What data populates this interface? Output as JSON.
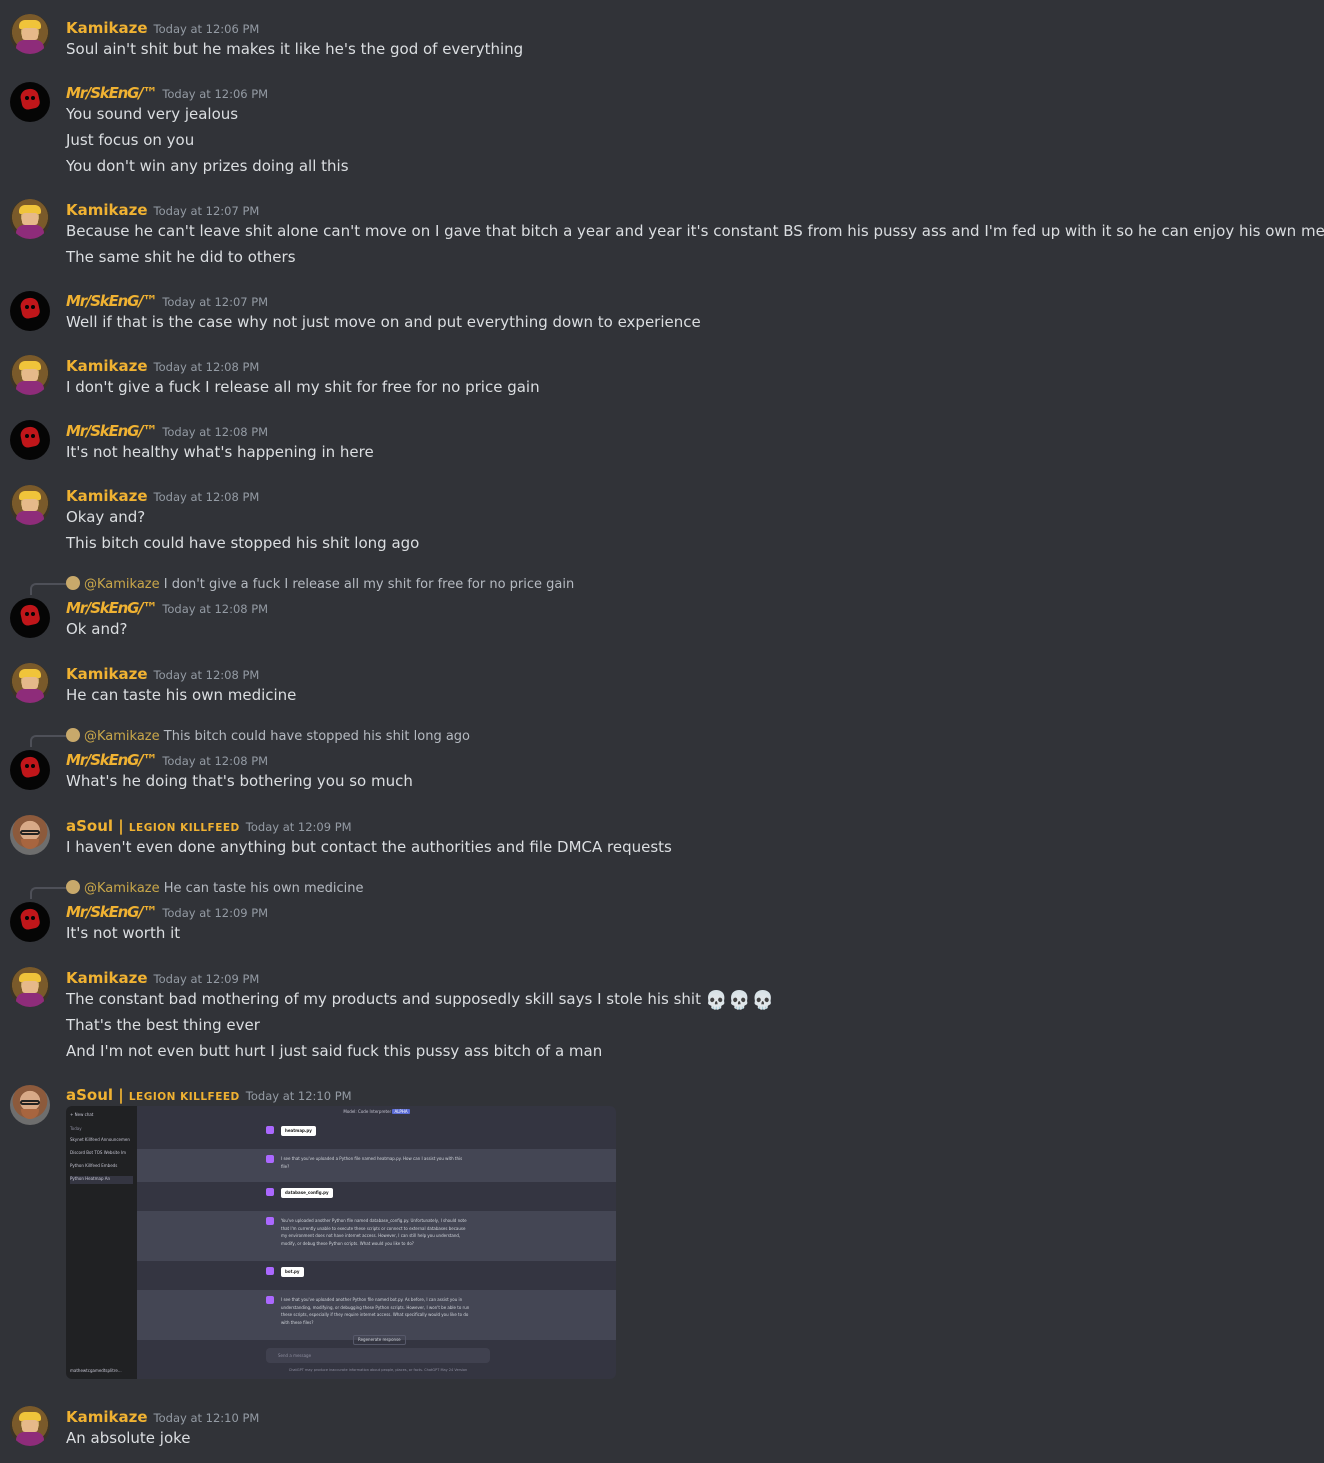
{
  "messages": [
    {
      "user": "Kamikaze",
      "time": "Today at 12:06 PM",
      "lines": [
        "Soul ain't shit but he makes it like he's the god of everything"
      ]
    },
    {
      "user": "Mr/SkEnG/™",
      "time": "Today at 12:06 PM",
      "lines": [
        "You sound very jealous",
        "Just focus on you",
        "You don't win any prizes doing all this"
      ]
    },
    {
      "user": "Kamikaze",
      "time": "Today at 12:07 PM",
      "lines": [
        "Because he can't leave shit alone can't move on I gave that bitch a year and year it's constant BS from his pussy ass and I'm fed up with it so he can enjoy his own medicine",
        "The same shit he did to others"
      ]
    },
    {
      "user": "Mr/SkEnG/™",
      "time": "Today at 12:07 PM",
      "lines": [
        "Well if that is the case why not just move on and put everything down to experience"
      ]
    },
    {
      "user": "Kamikaze",
      "time": "Today at 12:08 PM",
      "lines": [
        "I don't give a fuck I release all my shit for free for no price gain"
      ]
    },
    {
      "user": "Mr/SkEnG/™",
      "time": "Today at 12:08 PM",
      "lines": [
        "It's not healthy what's happening in here"
      ]
    },
    {
      "user": "Kamikaze",
      "time": "Today at 12:08 PM",
      "lines": [
        "Okay and?",
        "This bitch could have stopped his shit long ago"
      ]
    },
    {
      "reply_mention": "@Kamikaze",
      "reply_text": "I don't give a fuck I release all my shit for free for no price gain",
      "user": "Mr/SkEnG/™",
      "time": "Today at 12:08 PM",
      "lines": [
        "Ok and?"
      ]
    },
    {
      "user": "Kamikaze",
      "time": "Today at 12:08 PM",
      "lines": [
        "He can taste his own medicine"
      ]
    },
    {
      "reply_mention": "@Kamikaze",
      "reply_text": "This bitch could have stopped his shit long ago",
      "user": "Mr/SkEnG/™",
      "time": "Today at 12:08 PM",
      "lines": [
        "What's he doing that's bothering you so much"
      ]
    },
    {
      "user": "aSoul |",
      "tag": "LEGION KILLFEED",
      "time": "Today at 12:09 PM",
      "lines": [
        "I haven't even done anything but contact the authorities and file DMCA requests"
      ]
    },
    {
      "reply_mention": "@Kamikaze",
      "reply_text": "He can taste his own medicine",
      "user": "Mr/SkEnG/™",
      "time": "Today at 12:09 PM",
      "lines": [
        "It's not worth it"
      ]
    },
    {
      "user": "Kamikaze",
      "time": "Today at 12:09 PM",
      "lines": [
        "The constant bad mothering of my products and supposedly skill says I stole his shit",
        "That's the best thing ever",
        "And I'm not even butt hurt I just said fuck this pussy ass bitch of a man"
      ],
      "emoji": "💀💀💀"
    },
    {
      "user": "aSoul |",
      "tag": "LEGION KILLFEED",
      "time": "Today at 12:10 PM",
      "lines": []
    },
    {
      "user": "Kamikaze",
      "time": "Today at 12:10 PM",
      "lines": [
        "An absolute joke"
      ]
    }
  ],
  "attachment": {
    "title": "Model: Code Interpreter",
    "badge": "ALPHA",
    "new_chat": "New chat",
    "today": "Today",
    "history": [
      "Skynet Killfeed Announcemen",
      "Discord Bot TOS Website Im",
      "Python Killfeed Embeds",
      "Python Heatmap An"
    ],
    "account": "mathewtcgamedtsplitre...",
    "files": [
      "heatmap.py",
      "database_config.py",
      "bot.py"
    ],
    "replies": [
      "I see that you've uploaded a Python file named heatmap.py. How can I assist you with this file?",
      "You've uploaded another Python file named database_config.py. Unfortunately, I should note that I'm currently unable to execute these scripts or connect to external databases because my environment does not have internet access. However, I can still help you understand, modify, or debug these Python scripts. What would you like to do?",
      "I see that you've uploaded another Python file named bot.py. As before, I can assist you in understanding, modifying, or debugging these Python scripts. However, I won't be able to run these scripts, especially if they require internet access. What specifically would you like to do with these files?"
    ],
    "regenerate": "Regenerate response",
    "placeholder": "Send a message",
    "footer": "ChatGPT may produce inaccurate information about people, places, or facts. ChatGPT May 24 Version"
  }
}
